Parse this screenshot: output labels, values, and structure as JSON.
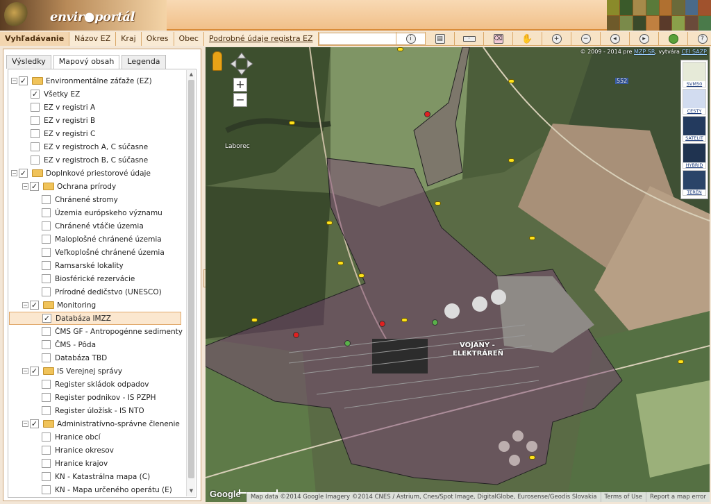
{
  "app": {
    "logo_text": "envir●portál"
  },
  "nav": {
    "tabs": [
      "Vyhľadávanie",
      "Názov EZ",
      "Kraj",
      "Okres",
      "Obec",
      "Podrobné údaje registra EZ"
    ],
    "search_value": ""
  },
  "toolbar": {
    "tools": [
      "info-icon",
      "print-icon",
      "measure-icon",
      "eraser-icon",
      "hand-icon",
      "zoom-in-icon",
      "zoom-out-icon",
      "zoom-prev-icon",
      "zoom-next-icon",
      "globe-icon",
      "help-icon"
    ]
  },
  "left_tabs": {
    "t1": "Výsledky",
    "t2": "Mapový obsah",
    "t3": "Legenda"
  },
  "tree": {
    "env": {
      "label": "Environmentálne záťaže (EZ)",
      "items": [
        "Všetky EZ",
        "EZ v registri A",
        "EZ v registri B",
        "EZ v registri C",
        "EZ v registroch A, C súčasne",
        "EZ v registroch B, C súčasne"
      ]
    },
    "dopl": {
      "label": "Doplnkové priestorové údaje"
    },
    "ochrana": {
      "label": "Ochrana prírody",
      "items": [
        "Chránené stromy",
        "Územia európskeho významu",
        "Chránené vtáčie územia",
        "Maloplošné chránené územia",
        "Veľkoplošné chránené územia",
        "Ramsarské lokality",
        "Biosférické rezervácie",
        "Prírodné dedičstvo (UNESCO)"
      ]
    },
    "monitoring": {
      "label": "Monitoring",
      "items": [
        "Databáza IMZZ",
        "ČMS GF - Antropogénne sedimenty",
        "ČMS - Pôda",
        "Databáza TBD"
      ]
    },
    "is": {
      "label": "IS Verejnej správy",
      "items": [
        "Register skládok odpadov",
        "Register podnikov - IS PZPH",
        "Register úložísk - IS NTO"
      ]
    },
    "admin": {
      "label": "Administratívno-správne členenie",
      "items": [
        "Hranice obcí",
        "Hranice okresov",
        "Hranice krajov",
        "KN - Katastrálna mapa (C)",
        "KN - Mapa určeného operátu (E)"
      ]
    }
  },
  "map": {
    "copyright_prefix": "© 2009 - 2014 pre",
    "copyright_link1": "MZP SR",
    "copyright_mid": ", vytvára",
    "copyright_link2": "CEI SAZP",
    "layers": [
      "SVM50",
      "CESTY",
      "SATELIT",
      "HYBRID",
      "TERÉN"
    ],
    "labels": {
      "river": "Laborec",
      "road": "552",
      "plant1": "VOJANY -",
      "plant2": "ELEKTRÁREŇ"
    },
    "google": "Google",
    "attribution": [
      "Map data ©2014 Google Imagery ©2014 CNES / Astrium, Cnes/Spot Image, DigitalGlobe, Eurosense/Geodis Slovakia",
      "Terms of Use",
      "Report a map error"
    ],
    "colors": {
      "overlay": "#7a3e78",
      "accent": "#d98c3a"
    }
  }
}
